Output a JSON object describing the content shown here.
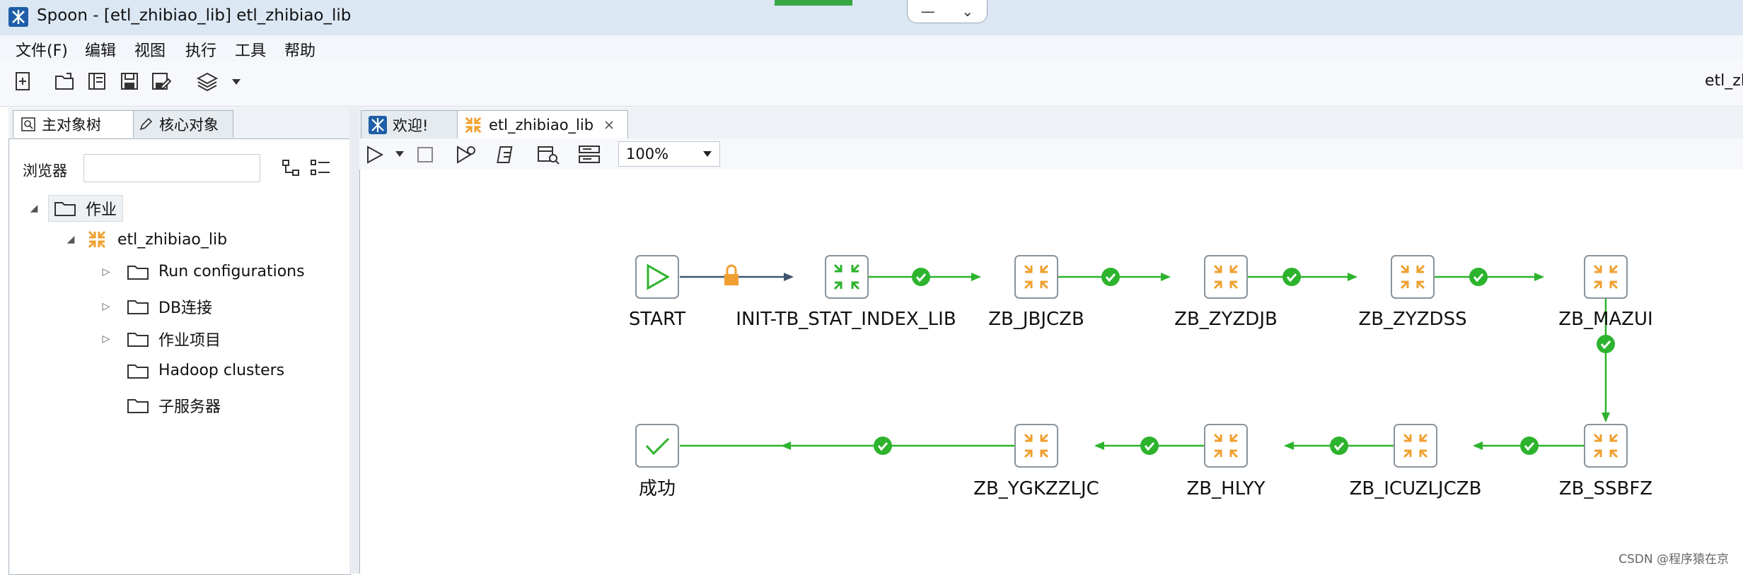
{
  "window": {
    "title": "Spoon - [etl_zhibiao_lib] etl_zhibiao_lib"
  },
  "window_controls": {
    "minimize": "—",
    "menu": "⌄"
  },
  "menu": [
    "文件(F)",
    "编辑",
    "视图",
    "执行",
    "工具",
    "帮助"
  ],
  "toolbar": {
    "right_text": "etl_zhi"
  },
  "left_tabs": [
    {
      "label": "主对象树"
    },
    {
      "label": "核心对象"
    }
  ],
  "browser": {
    "label": "浏览器",
    "value": ""
  },
  "tree": {
    "root": "作业",
    "job": "etl_zhibiao_lib",
    "children": [
      "Run configurations",
      "DB连接",
      "作业项目",
      "Hadoop clusters",
      "子服务器"
    ]
  },
  "editor_tabs": [
    {
      "label": "欢迎!"
    },
    {
      "label": "etl_zhibiao_lib"
    }
  ],
  "zoom": "100%",
  "flow": {
    "row1": [
      "START",
      "INIT-TB_STAT_INDEX_LIB",
      "ZB_JBJCZB",
      "ZB_ZYZDJB",
      "ZB_ZYZDSS",
      "ZB_MAZUI"
    ],
    "row2": [
      "成功",
      "ZB_YGKZZLJC",
      "ZB_HLYY",
      "ZB_ICUZLJCZB",
      "ZB_SSBFZ"
    ]
  },
  "colors": {
    "hop_green": "#2db32d",
    "hop_dark": "#40566f",
    "job_orange": "#f0a030",
    "start_green": "#2db32d"
  },
  "watermark": "CSDN @程序猿在京"
}
